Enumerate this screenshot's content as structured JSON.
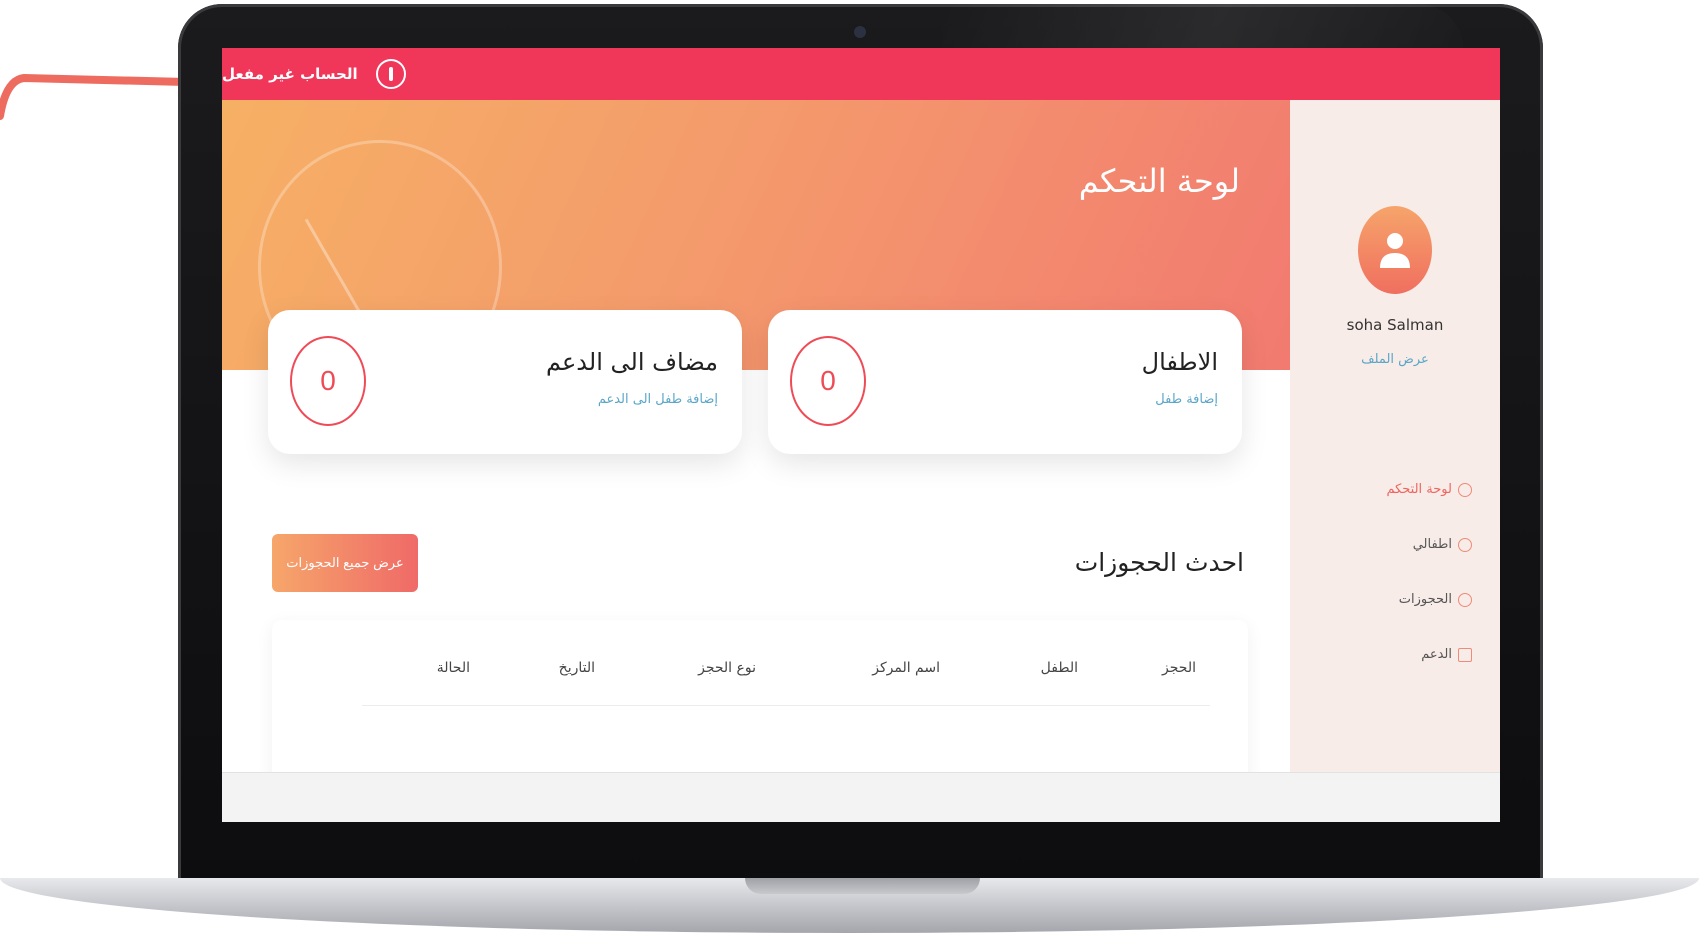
{
  "alert": {
    "text": "الحساب غير مفعل"
  },
  "user": {
    "name": "soha Salman",
    "view_profile": "عرض الملف"
  },
  "nav": [
    {
      "label": "لوحة التحكم",
      "icon": "dashboard-icon",
      "active": true
    },
    {
      "label": "اطفالي",
      "icon": "children-icon",
      "active": false
    },
    {
      "label": "الحجوزات",
      "icon": "check-circle-icon",
      "active": false
    },
    {
      "label": "الدعم",
      "icon": "calendar-icon",
      "active": false
    }
  ],
  "main": {
    "title": "لوحة التحكم",
    "cards": [
      {
        "title": "الاطفال",
        "link": "إضافة طفل",
        "count": "0"
      },
      {
        "title": "مضاف الى الدعم",
        "link": "إضافة طفل الى الدعم",
        "count": "0"
      }
    ],
    "latest_bookings": {
      "title": "احدث الحجوزات",
      "button": "عرض جميع الحجوزات",
      "columns": [
        "الحجز",
        "الطفل",
        "اسم المركز",
        "نوع الحجز",
        "التاريخ",
        "الحالة"
      ]
    }
  },
  "colors": {
    "alert_bar": "#f0375a",
    "sidebar_bg": "#f7ece7",
    "accent": "#ef4b56",
    "link": "#5aa6c8"
  }
}
